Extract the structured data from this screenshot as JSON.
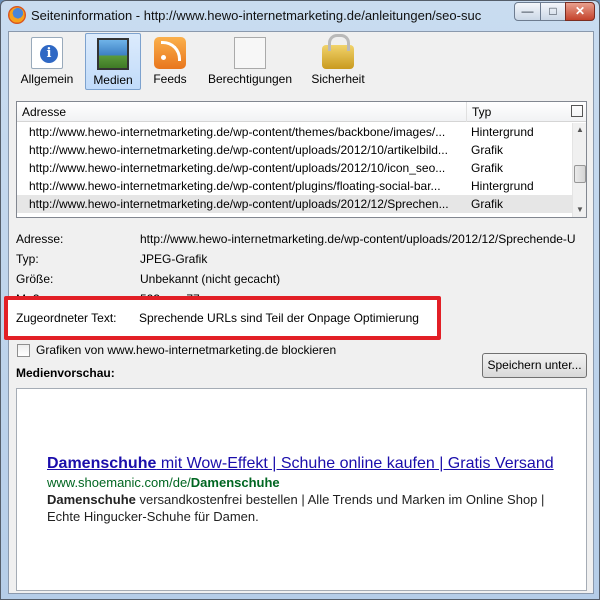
{
  "window": {
    "title": "Seiteninformation - http://www.hewo-internetmarketing.de/anleitungen/seo-suchm...",
    "controls": {
      "minimize": "—",
      "maximize": "□",
      "close": "✕"
    }
  },
  "toolbar": {
    "tabs": [
      {
        "label": "Allgemein",
        "icon": "info-icon"
      },
      {
        "label": "Medien",
        "icon": "media-icon",
        "selected": true
      },
      {
        "label": "Feeds",
        "icon": "rss-feed-icon"
      },
      {
        "label": "Berechtigungen",
        "icon": "permissions-icon"
      },
      {
        "label": "Sicherheit",
        "icon": "lock-icon"
      }
    ]
  },
  "media_list": {
    "columns": {
      "address": "Adresse",
      "type": "Typ"
    },
    "rows": [
      {
        "address": "http://www.hewo-internetmarketing.de/wp-content/themes/backbone/images/...",
        "type": "Hintergrund"
      },
      {
        "address": "http://www.hewo-internetmarketing.de/wp-content/uploads/2012/10/artikelbild...",
        "type": "Grafik"
      },
      {
        "address": "http://www.hewo-internetmarketing.de/wp-content/uploads/2012/10/icon_seo...",
        "type": "Grafik"
      },
      {
        "address": "http://www.hewo-internetmarketing.de/wp-content/plugins/floating-social-bar...",
        "type": "Hintergrund"
      },
      {
        "address": "http://www.hewo-internetmarketing.de/wp-content/uploads/2012/12/Sprechen...",
        "type": "Grafik",
        "selected": true
      }
    ]
  },
  "details": {
    "address_label": "Adresse:",
    "address_value": "http://www.hewo-internetmarketing.de/wp-content/uploads/2012/12/Sprechende-U",
    "type_label": "Typ:",
    "type_value": "JPEG-Grafik",
    "size_label": "Größe:",
    "size_value": "Unbekannt (nicht gecacht)",
    "dimensions_label": "Maße:",
    "dimensions_value": "523px × 77px",
    "alt_label": "Zugeordneter Text:",
    "alt_value": "Sprechende URLs sind Teil der Onpage Optimierung"
  },
  "block_checkbox": {
    "label": "Grafiken von www.hewo-internetmarketing.de blockieren",
    "checked": false
  },
  "save_button": "Speichern unter...",
  "preview": {
    "heading": "Medienvorschau:",
    "ad_title_bold": "Damenschuhe",
    "ad_title_rest": " mit Wow-Effekt | Schuhe online kaufen | Gratis Versand",
    "ad_url_prefix": "www.shoemanic.com/de/",
    "ad_url_bold": "Damenschuhe",
    "ad_desc_bold": "Damenschuhe",
    "ad_desc_rest": " versandkostenfrei bestellen | Alle Trends und Marken im Online Shop | Echte Hingucker-Schuhe für Damen."
  }
}
